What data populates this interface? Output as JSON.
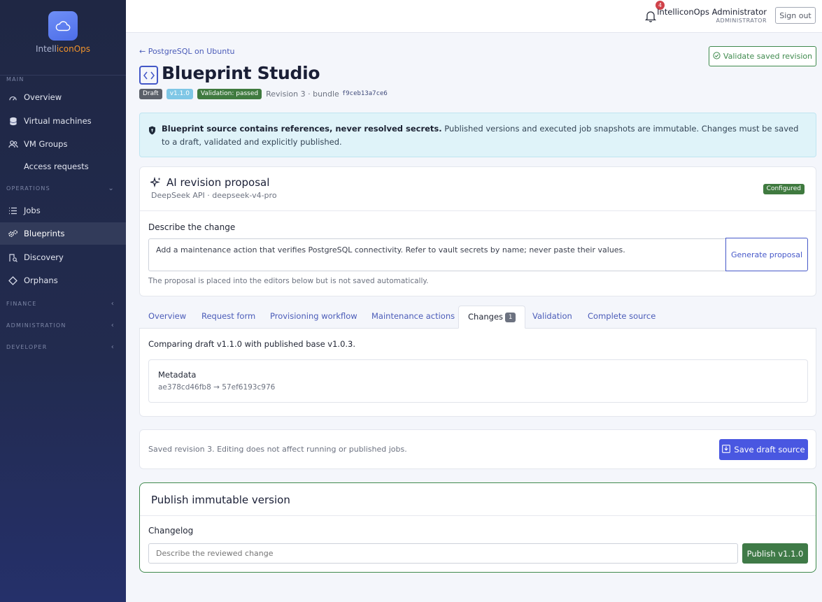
{
  "brand": {
    "name_prefix": "Intell",
    "name_accent": "iconOps"
  },
  "sidebar": {
    "sections": {
      "main": "MAIN",
      "operations": "OPERATIONS",
      "finance": "FINANCE",
      "administration": "ADMINISTRATION",
      "developer": "DEVELOPER"
    },
    "items": [
      {
        "label": "Overview",
        "icon": "dashboard-icon"
      },
      {
        "label": "Virtual machines",
        "icon": "database-icon"
      },
      {
        "label": "VM Groups",
        "icon": "users-icon"
      },
      {
        "label": "Access requests",
        "icon": ""
      },
      {
        "label": "Jobs",
        "icon": "list-icon"
      },
      {
        "label": "Blueprints",
        "icon": "gears-icon",
        "active": true
      },
      {
        "label": "Discovery",
        "icon": "building-icon"
      },
      {
        "label": "Orphans",
        "icon": "diamond-icon"
      }
    ]
  },
  "topbar": {
    "notification_count": "4",
    "user_name": "IntelliconOps Administrator",
    "user_role": "ADMINISTRATOR",
    "signout_label": "Sign out"
  },
  "header": {
    "back_link": "← PostgreSQL on Ubuntu",
    "title": "Blueprint Studio",
    "validate_label": "Validate saved revision",
    "badge_draft": "Draft",
    "badge_version": "v1.1.0",
    "badge_validation": "Validation: passed",
    "revision_text": "Revision 3 · bundle",
    "bundle_hash": "f9ceb13a7ce6"
  },
  "alert": {
    "bold": "Blueprint source contains references, never resolved secrets.",
    "text": " Published versions and executed job snapshots are immutable. Changes must be saved to a draft, validated and explicitly published."
  },
  "ai": {
    "title": "AI revision proposal",
    "subtitle": "DeepSeek API · deepseek-v4-pro",
    "status": "Configured",
    "label": "Describe the change",
    "prompt_value": "Add a maintenance action that verifies PostgreSQL connectivity. Refer to vault secrets by name; never paste their values.",
    "generate_label": "Generate proposal",
    "hint": "The proposal is placed into the editors below but is not saved automatically."
  },
  "tabs": [
    {
      "label": "Overview"
    },
    {
      "label": "Request form"
    },
    {
      "label": "Provisioning workflow"
    },
    {
      "label": "Maintenance actions"
    },
    {
      "label": "Changes",
      "count": "1",
      "active": true
    },
    {
      "label": "Validation"
    },
    {
      "label": "Complete source"
    }
  ],
  "changes": {
    "compare_text": "Comparing draft v1.1.0 with published base v1.0.3.",
    "meta_title": "Metadata",
    "meta_hash": "ae378cd46fb8 → 57ef6193c976"
  },
  "save": {
    "text": "Saved revision 3. Editing does not affect running or published jobs.",
    "button_label": "Save draft source"
  },
  "publish": {
    "title": "Publish immutable version",
    "changelog_label": "Changelog",
    "changelog_placeholder": "Describe the reviewed change",
    "button_label": "Publish v1.1.0"
  },
  "colors": {
    "sidebar_bg": "#1f2744",
    "primary": "#4957e1",
    "success": "#3f7a3f",
    "link": "#4a5bb8",
    "brand_accent": "#f0932b"
  }
}
